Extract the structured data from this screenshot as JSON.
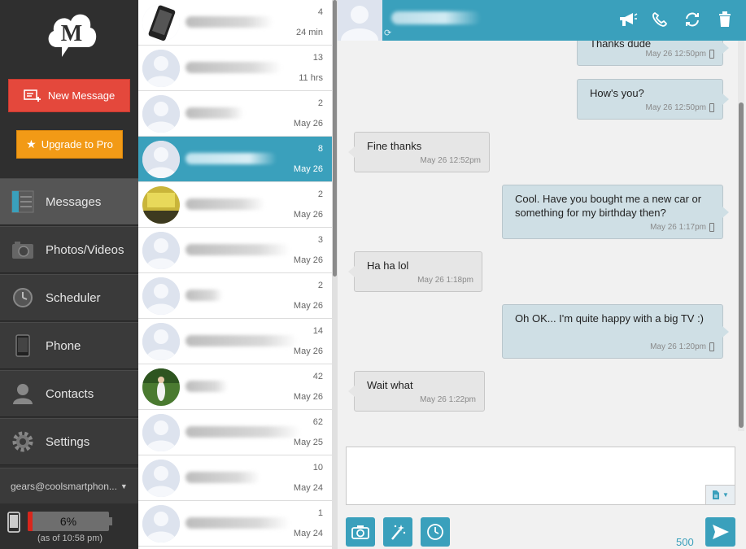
{
  "colors": {
    "accent": "#3aa0bc",
    "new_message": "#e4483c",
    "upgrade": "#f29a16",
    "battery_low": "#d9261c"
  },
  "sidebar": {
    "logo_letter": "M",
    "new_message_label": "New Message",
    "upgrade_label": "Upgrade to Pro",
    "nav": [
      {
        "label": "Messages",
        "icon": "messages-icon",
        "active": true
      },
      {
        "label": "Photos/Videos",
        "icon": "camera-icon"
      },
      {
        "label": "Scheduler",
        "icon": "clock-icon"
      },
      {
        "label": "Phone",
        "icon": "phone-device-icon"
      },
      {
        "label": "Contacts",
        "icon": "contact-icon"
      },
      {
        "label": "Settings",
        "icon": "gear-icon"
      }
    ],
    "account": "gears@coolsmartphon...",
    "battery": {
      "percent_label": "6%",
      "level": 0.06,
      "as_of": "(as of 10:58 pm)"
    }
  },
  "conversations": [
    {
      "count": "4",
      "time": "24 min",
      "avatar": "phone-photo"
    },
    {
      "count": "13",
      "time": "11 hrs",
      "avatar": "default"
    },
    {
      "count": "2",
      "time": "May 26",
      "avatar": "default"
    },
    {
      "count": "8",
      "time": "May 26",
      "avatar": "default",
      "active": true
    },
    {
      "count": "2",
      "time": "May 26",
      "avatar": "photo-yellow"
    },
    {
      "count": "3",
      "time": "May 26",
      "avatar": "default"
    },
    {
      "count": "2",
      "time": "May 26",
      "avatar": "default"
    },
    {
      "count": "14",
      "time": "May 26",
      "avatar": "default"
    },
    {
      "count": "42",
      "time": "May 26",
      "avatar": "photo-green"
    },
    {
      "count": "62",
      "time": "May 25",
      "avatar": "default"
    },
    {
      "count": "10",
      "time": "May 24",
      "avatar": "default"
    },
    {
      "count": "1",
      "time": "May 24",
      "avatar": "default"
    }
  ],
  "chat": {
    "messages": [
      {
        "dir": "out",
        "text": "Thanks dude",
        "time": "May 26 12:50pm"
      },
      {
        "dir": "out",
        "text": "How's you?",
        "time": "May 26 12:50pm"
      },
      {
        "dir": "in",
        "text": "Fine thanks",
        "time": "May 26 12:52pm"
      },
      {
        "dir": "out",
        "text": "Cool. Have you bought me a new car or something for my birthday then?",
        "time": "May 26 1:17pm"
      },
      {
        "dir": "in",
        "text": "Ha ha lol",
        "time": "May 26 1:18pm"
      },
      {
        "dir": "out",
        "text": "Oh OK... I'm quite happy with a big TV :)",
        "time": "May 26 1:20pm"
      },
      {
        "dir": "in",
        "text": "Wait what",
        "time": "May 26 1:22pm"
      }
    ],
    "composer_placeholder": "",
    "char_count": "500"
  }
}
